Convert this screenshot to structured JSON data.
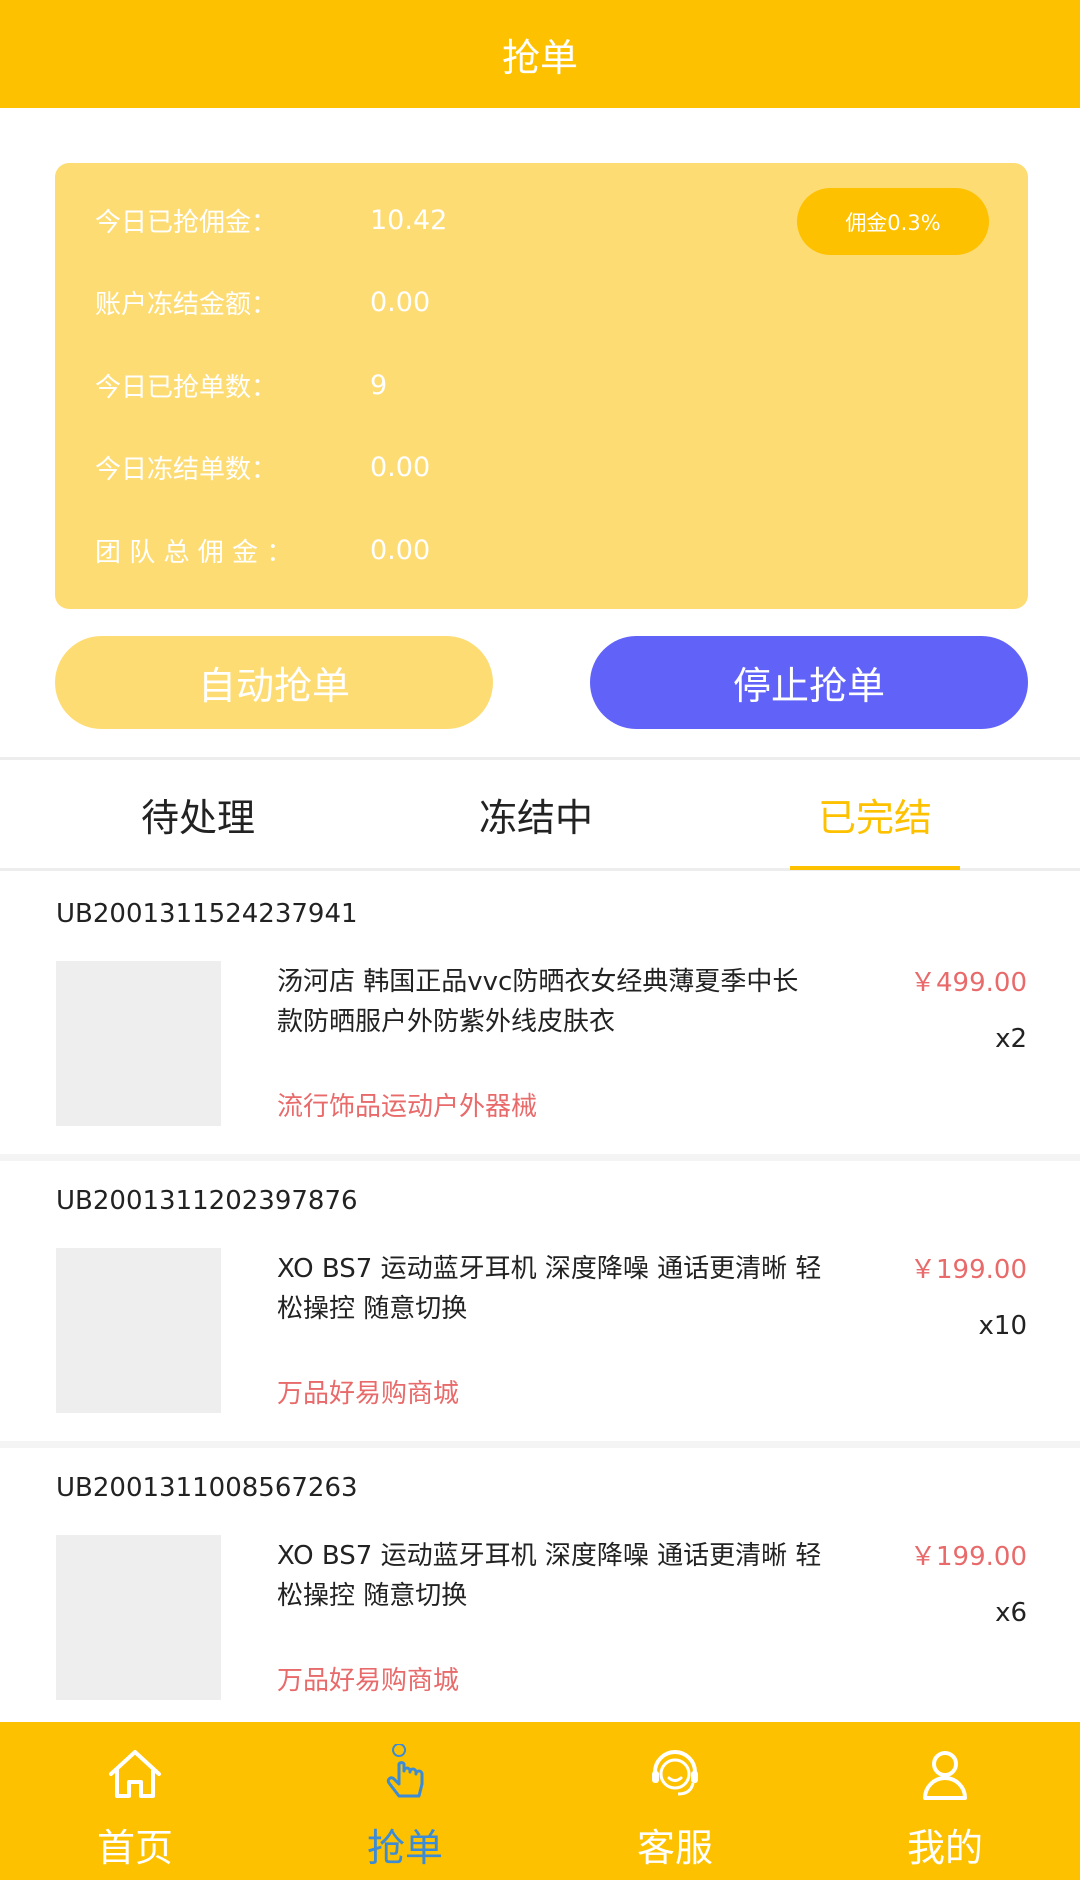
{
  "header": {
    "title": "抢单"
  },
  "stats": {
    "rows": [
      {
        "label": "今日已抢佣金：",
        "value": "10.42"
      },
      {
        "label": "账户冻结金额：",
        "value": "0.00"
      },
      {
        "label": "今日已抢单数：",
        "value": "9"
      },
      {
        "label": "今日冻结单数：",
        "value": "0.00"
      },
      {
        "label": "团 队 总 佣 金 ：",
        "value": "0.00"
      }
    ],
    "commission_badge": "佣金0.3%"
  },
  "buttons": {
    "auto_label": "自动抢单",
    "stop_label": "停止抢单"
  },
  "tabs": [
    {
      "label": "待处理",
      "active": false
    },
    {
      "label": "冻结中",
      "active": false
    },
    {
      "label": "已完结",
      "active": true
    }
  ],
  "orders": [
    {
      "order_no": "UB2001311524237941",
      "title": "汤河店 韩国正品vvc防晒衣女经典薄夏季中长款防晒服户外防紫外线皮肤衣",
      "shop": "流行饰品运动户外器械",
      "price": "￥499.00",
      "qty": "x2"
    },
    {
      "order_no": "UB2001311202397876",
      "title": "XO BS7 运动蓝牙耳机 深度降噪 通话更清晰 轻松操控 随意切换",
      "shop": "万品好易购商城",
      "price": "￥199.00",
      "qty": "x10"
    },
    {
      "order_no": "UB2001311008567263",
      "title": "XO BS7 运动蓝牙耳机 深度降噪 通话更清晰 轻松操控 随意切换",
      "shop": "万品好易购商城",
      "price": "￥199.00",
      "qty": "x6"
    }
  ],
  "tabbar": [
    {
      "label": "首页",
      "icon": "home-icon",
      "active": false
    },
    {
      "label": "抢单",
      "icon": "tap-hand-icon",
      "active": true
    },
    {
      "label": "客服",
      "icon": "headset-icon",
      "active": false
    },
    {
      "label": "我的",
      "icon": "user-icon",
      "active": false
    }
  ],
  "colors": {
    "brand_yellow": "#FDC100",
    "card_yellow": "#FEDC74",
    "stop_button": "#6163F8",
    "price_red": "#E86A6A",
    "active_tab_icon": "#3B8BD6"
  }
}
